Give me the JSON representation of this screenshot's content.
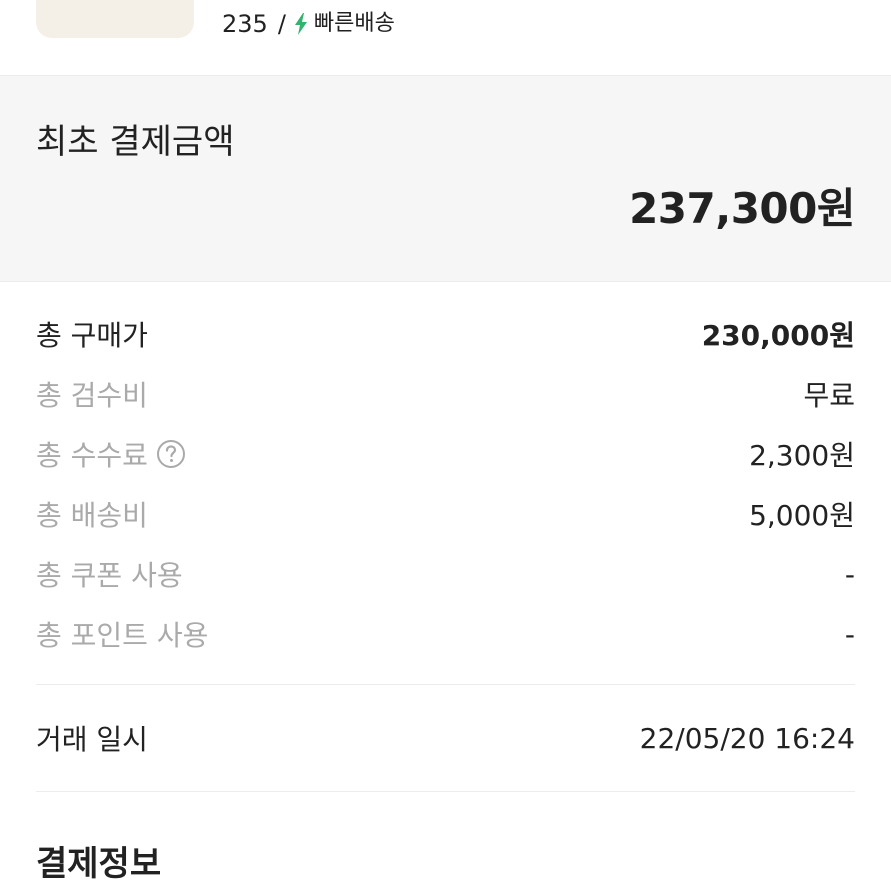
{
  "product": {
    "size": "235",
    "separator": "/",
    "delivery_label": "빠른배송",
    "bolt_color": "#31b46e"
  },
  "initial_payment": {
    "title": "최초 결제금액",
    "amount": "237,300원"
  },
  "breakdown": {
    "rows": [
      {
        "label": "총 구매가",
        "value": "230,000원"
      },
      {
        "label": "총 검수비",
        "value": "무료"
      },
      {
        "label": "총 수수료",
        "value": "2,300원"
      },
      {
        "label": "총 배송비",
        "value": "5,000원"
      },
      {
        "label": "총 쿠폰 사용",
        "value": "-"
      },
      {
        "label": "총 포인트 사용",
        "value": "-"
      }
    ]
  },
  "transaction": {
    "label": "거래 일시",
    "value": "22/05/20 16:24"
  },
  "payment_info": {
    "title": "결제정보"
  },
  "colors": {
    "label_muted": "#aaaaaa",
    "text_primary": "#222222",
    "panel_bg": "#f6f6f6",
    "accent_green": "#31b46e"
  }
}
